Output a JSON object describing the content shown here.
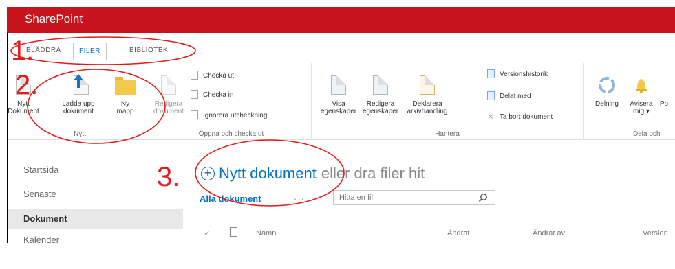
{
  "app": {
    "brand": "SharePoint",
    "bar_color": "#c8141c",
    "accent": "#0072c6",
    "annotation_color": "#e21b1b"
  },
  "ribbon_tabs": [
    "BLÄDDRA",
    "FILER",
    "BIBLIOTEK"
  ],
  "groups": {
    "nytt": {
      "label": "Nytt",
      "buttons": [
        {
          "line1": "Nytt",
          "line2": "Dokument",
          "icon": "new-document-icon"
        },
        {
          "line1": "Ladda upp",
          "line2": "dokument",
          "icon": "upload-icon"
        },
        {
          "line1": "Ny",
          "line2": "mapp",
          "icon": "folder-icon"
        }
      ]
    },
    "oppna": {
      "label": "Öppna och checka ut",
      "edit": {
        "line1": "Redigera",
        "line2": "dokument",
        "icon": "edit-document-icon"
      },
      "small": [
        {
          "label": "Checka ut",
          "icon": "check-out-icon"
        },
        {
          "label": "Checka in",
          "icon": "check-in-icon"
        },
        {
          "label": "Ignorera utcheckning",
          "icon": "discard-checkout-icon"
        }
      ]
    },
    "hantera": {
      "label": "Hantera",
      "buttons": [
        {
          "line1": "Visa",
          "line2": "egenskaper",
          "icon": "view-properties-icon"
        },
        {
          "line1": "Redigera",
          "line2": "egenskaper",
          "icon": "edit-properties-icon"
        },
        {
          "line1": "Deklarera",
          "line2": "arkivhandling",
          "icon": "declare-record-icon"
        }
      ],
      "small": [
        {
          "label": "Versionshistorik",
          "icon": "version-history-icon"
        },
        {
          "label": "Delat med",
          "icon": "shared-with-icon"
        },
        {
          "label": "Ta bort dokument",
          "icon": "delete-icon"
        }
      ]
    },
    "dela": {
      "label": "Dela och",
      "buttons": [
        {
          "line1": "Delning",
          "line2": "",
          "icon": "share-icon"
        },
        {
          "line1": "Avisera",
          "line2": "mig ▾",
          "icon": "alert-bell-icon"
        },
        {
          "line1": "Po",
          "line2": "",
          "icon": "popularity-icon"
        }
      ]
    }
  },
  "leftnav": [
    "Startsida",
    "Senaste",
    "Dokument",
    "Kalender"
  ],
  "leftnav_selected": "Dokument",
  "main": {
    "new_doc_link": "Nytt dokument",
    "new_doc_rest": "eller dra filer hit",
    "view_name": "Alla dokument",
    "more": "···",
    "search_placeholder": "Hitta en fil",
    "columns": [
      "Namn",
      "Ändrat",
      "Ändrat av",
      "Version"
    ]
  },
  "annotations": [
    "1.",
    "2.",
    "3."
  ]
}
